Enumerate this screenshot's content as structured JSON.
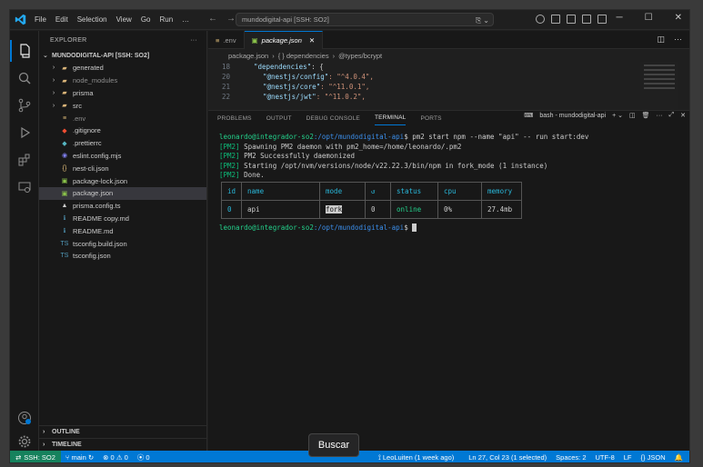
{
  "titlebar": {
    "menu": [
      "File",
      "Edit",
      "Selection",
      "View",
      "Go",
      "Run",
      "…"
    ],
    "command_center": "mundodigital-api [SSH: SO2]"
  },
  "sidebar": {
    "header": "EXPLORER",
    "root": "MUNDODIGITAL-API [SSH: SO2]",
    "items": [
      {
        "label": "generated",
        "kind": "folder",
        "icon_color": "#dcb67a"
      },
      {
        "label": "node_modules",
        "kind": "folder",
        "icon_color": "#dcb67a",
        "dim": true
      },
      {
        "label": "prisma",
        "kind": "folder",
        "icon_color": "#dcb67a"
      },
      {
        "label": "src",
        "kind": "folder",
        "icon_color": "#dcb67a"
      },
      {
        "label": ".env",
        "kind": "file",
        "icon": "≡",
        "icon_color": "#e5c07b",
        "dim": true
      },
      {
        "label": ".gitignore",
        "kind": "file",
        "icon": "◆",
        "icon_color": "#f14e32"
      },
      {
        "label": ".prettierrc",
        "kind": "file",
        "icon": "◆",
        "icon_color": "#56b6c2"
      },
      {
        "label": "eslint.config.mjs",
        "kind": "file",
        "icon": "◉",
        "icon_color": "#8080f2"
      },
      {
        "label": "nest-cli.json",
        "kind": "file",
        "icon": "{}",
        "icon_color": "#e5c07b"
      },
      {
        "label": "package-lock.json",
        "kind": "file",
        "icon": "▣",
        "icon_color": "#8bc34a"
      },
      {
        "label": "package.json",
        "kind": "file",
        "icon": "▣",
        "icon_color": "#8bc34a",
        "selected": true
      },
      {
        "label": "prisma.config.ts",
        "kind": "file",
        "icon": "▲",
        "icon_color": "#cccccc"
      },
      {
        "label": "README copy.md",
        "kind": "file",
        "icon": "ℹ",
        "icon_color": "#519aba"
      },
      {
        "label": "README.md",
        "kind": "file",
        "icon": "ℹ",
        "icon_color": "#519aba"
      },
      {
        "label": "tsconfig.build.json",
        "kind": "file",
        "icon": "TS",
        "icon_color": "#519aba"
      },
      {
        "label": "tsconfig.json",
        "kind": "file",
        "icon": "TS",
        "icon_color": "#519aba"
      }
    ],
    "outline": "OUTLINE",
    "timeline": "TIMELINE"
  },
  "editor": {
    "tabs": [
      {
        "label": ".env",
        "active": false
      },
      {
        "label": "package.json",
        "active": true
      }
    ],
    "breadcrumbs": [
      "package.json",
      "{ } dependencies",
      "@types/bcrypt"
    ],
    "lines": [
      {
        "num": "18",
        "key": "\"dependencies\"",
        "rest": ": {"
      },
      {
        "num": "20",
        "key": "\"@nestjs/config\"",
        "rest": ": \"^4.0.4\","
      },
      {
        "num": "21",
        "key": "\"@nestjs/core\"",
        "rest": ": \"^11.0.1\","
      },
      {
        "num": "22",
        "key": "\"@nestjs/jwt\"",
        "rest": ": \"^11.0.2\","
      }
    ]
  },
  "panel": {
    "tabs": [
      "PROBLEMS",
      "OUTPUT",
      "DEBUG CONSOLE",
      "TERMINAL",
      "PORTS"
    ],
    "active_tab": "TERMINAL",
    "terminal_name": "bash - mundodigital-api",
    "terminal": {
      "prompt_user": "leonardo@integrador-so2",
      "prompt_path": ":/opt/mundodigital-api",
      "command": "$ pm2 start npm --name \"api\" -- run start:dev",
      "pm2_tag": "[PM2]",
      "messages": [
        "Spawning PM2 daemon with pm2_home=/home/leonardo/.pm2",
        "PM2 Successfully daemonized",
        "Starting /opt/nvm/versions/node/v22.22.3/bin/npm in fork_mode (1 instance)",
        "Done."
      ],
      "table_headers": [
        "id",
        "name",
        "mode",
        "↺",
        "status",
        "cpu",
        "memory"
      ],
      "table_row": [
        "0",
        "api",
        "fork",
        "0",
        "online",
        "0%",
        "27.4mb"
      ],
      "prompt2_suffix": "$"
    }
  },
  "statusbar": {
    "remote": "SSH: SO2",
    "branch": "main",
    "errors": "0",
    "warnings": "0",
    "ports": "0",
    "blame": "LeoLuiten (1 week ago)",
    "position": "Ln 27, Col 23 (1 selected)",
    "spaces": "Spaces: 2",
    "encoding": "UTF-8",
    "eol": "LF",
    "language": "JSON"
  },
  "tooltip": "Buscar",
  "colors": {
    "accent": "#0078d4",
    "remote": "#16825d",
    "terminal_green": "#23d18b",
    "terminal_blue": "#3b8eea"
  }
}
